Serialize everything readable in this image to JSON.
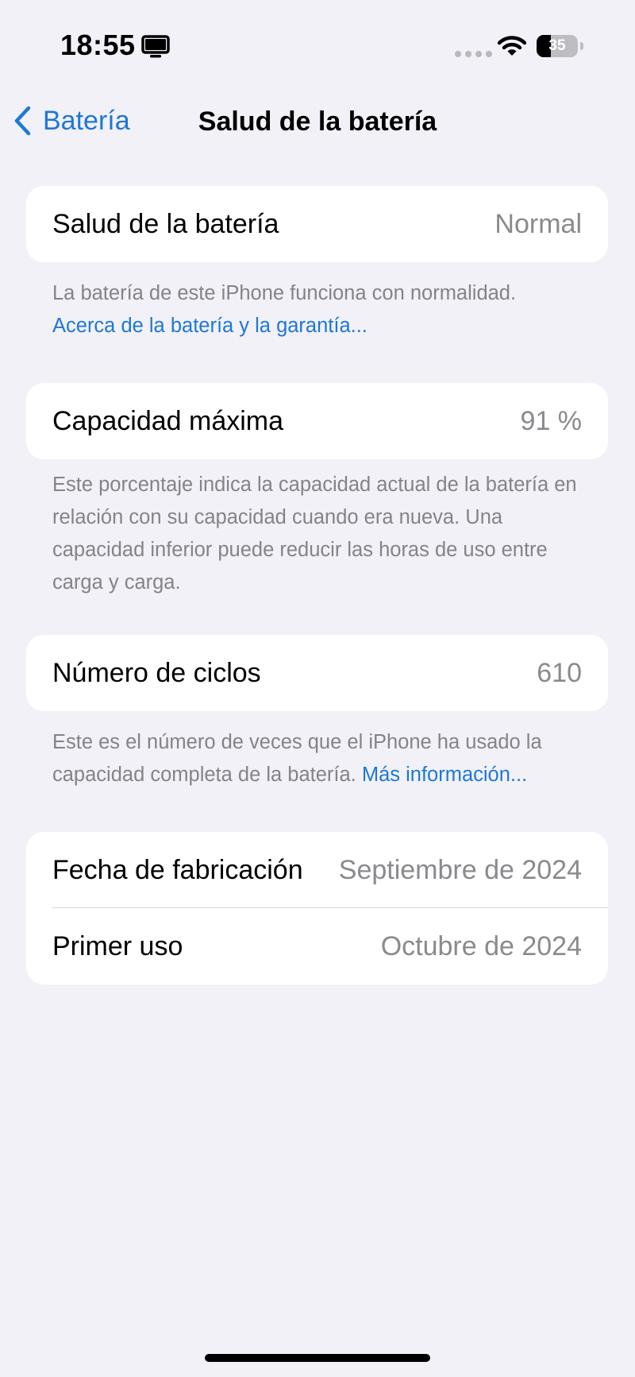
{
  "status_bar": {
    "time": "18:55",
    "battery_level": "35",
    "battery_fraction": 0.35,
    "icons": [
      "screen-mirroring-icon",
      "cellular-dots-icon",
      "wifi-icon",
      "battery-icon"
    ]
  },
  "nav": {
    "back_label": "Batería",
    "title": "Salud de la batería"
  },
  "sections": {
    "health": {
      "label": "Salud de la batería",
      "value": "Normal",
      "footnote": "La batería de este iPhone funciona con normalidad.",
      "footnote_link": "Acerca de la batería y la garantía..."
    },
    "capacity": {
      "label": "Capacidad máxima",
      "value": "91 %",
      "footnote": "Este porcentaje indica la capacidad actual de la batería en relación con su capacidad cuando era nueva. Una capacidad inferior puede reducir las horas de uso entre carga y carga."
    },
    "cycles": {
      "label": "Número de ciclos",
      "value": "610",
      "footnote": "Este es el número de veces que el iPhone ha usado la capacidad completa de la batería.",
      "footnote_link": "Más información..."
    },
    "dates": {
      "manufacture_label": "Fecha de fabricación",
      "manufacture_value": "Septiembre de 2024",
      "first_use_label": "Primer uso",
      "first_use_value": "Octubre de 2024"
    }
  },
  "colors": {
    "background": "#f2f1f7",
    "accent": "#1d78d6",
    "secondary_text": "#8a8a8e"
  }
}
